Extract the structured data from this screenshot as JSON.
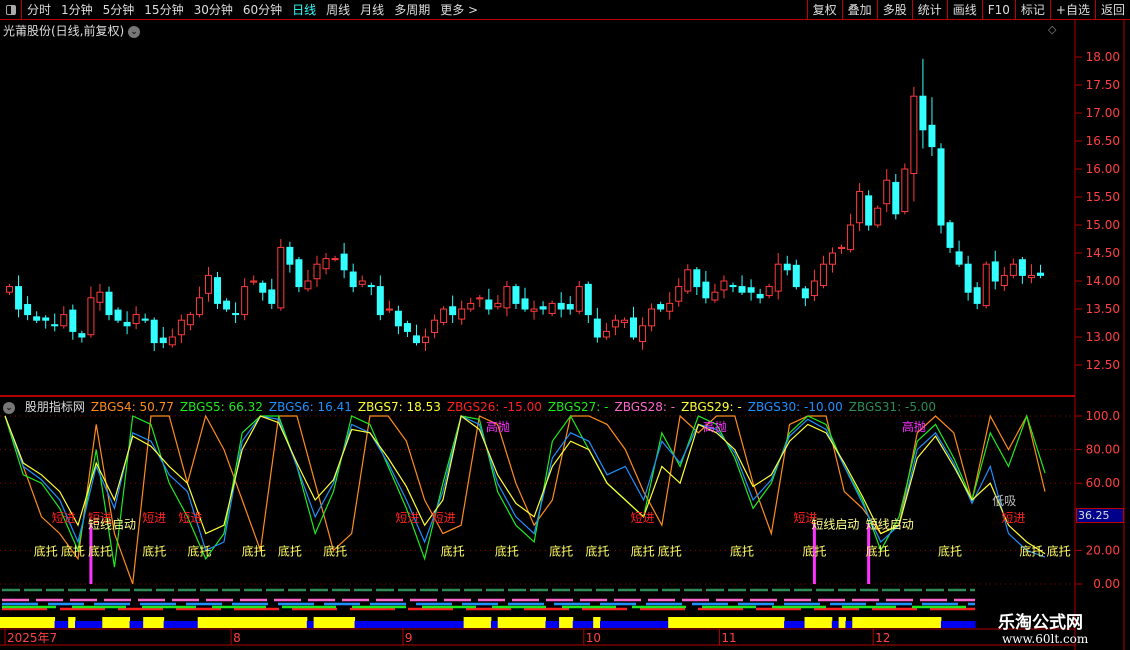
{
  "toolbar": {
    "periods": [
      "分时",
      "1分钟",
      "5分钟",
      "15分钟",
      "30分钟",
      "60分钟",
      "日线",
      "周线",
      "月线",
      "多周期",
      "更多 >"
    ],
    "active": "日线",
    "right": [
      "复权",
      "叠加",
      "多股",
      "统计",
      "画线",
      "F10",
      "标记",
      "+自选",
      "返回"
    ]
  },
  "title": "光莆股份(日线,前复权)",
  "price_axis": [
    "18.00",
    "17.50",
    "17.00",
    "16.50",
    "16.00",
    "15.50",
    "15.00",
    "14.50",
    "14.00",
    "13.50",
    "13.00",
    "12.50"
  ],
  "ind_axis": [
    "100.0",
    "80.00",
    "60.00",
    "20.00",
    "0.00"
  ],
  "current_value": "36.25",
  "indicator": {
    "name": "股朋指标网",
    "items": [
      {
        "t": "ZBGS4: 50.77",
        "c": "#ff8c1a"
      },
      {
        "t": "ZBGS5: 66.32",
        "c": "#1eea1e"
      },
      {
        "t": "ZBGS6: 16.41",
        "c": "#1e90ff"
      },
      {
        "t": "ZBGS7: 18.53",
        "c": "#ffff33"
      },
      {
        "t": "ZBGS26: -15.00",
        "c": "#ff2020"
      },
      {
        "t": "ZBGS27: -",
        "c": "#1eea1e"
      },
      {
        "t": "ZBGS28: -",
        "c": "#ff66cc"
      },
      {
        "t": "ZBGS29: -",
        "c": "#ffff33"
      },
      {
        "t": "ZBGS30: -10.00",
        "c": "#1e90ff"
      },
      {
        "t": "ZBGS31: -5.00",
        "c": "#2e8b57"
      }
    ]
  },
  "colors": {
    "up": "#ff3b3b",
    "down": "#3ff",
    "grid": "#b00000"
  },
  "closes": [
    13.9,
    13.5,
    13.4,
    13.3,
    13.3,
    13.2,
    13.4,
    13.1,
    13.0,
    13.7,
    13.8,
    13.4,
    13.3,
    13.2,
    13.4,
    13.3,
    12.9,
    12.9,
    13.0,
    13.3,
    13.4,
    13.7,
    14.1,
    13.6,
    13.5,
    13.4,
    13.9,
    14.0,
    13.8,
    13.6,
    14.6,
    14.3,
    13.9,
    14.0,
    14.3,
    14.4,
    14.4,
    14.2,
    13.9,
    14.0,
    13.9,
    13.4,
    13.5,
    13.2,
    13.1,
    12.9,
    13.0,
    13.3,
    13.5,
    13.4,
    13.5,
    13.6,
    13.7,
    13.5,
    13.6,
    13.9,
    13.6,
    13.5,
    13.5,
    13.5,
    13.6,
    13.5,
    13.5,
    13.9,
    13.4,
    13.0,
    13.1,
    13.3,
    13.3,
    13.0,
    13.2,
    13.5,
    13.5,
    13.6,
    13.9,
    14.2,
    13.9,
    13.7,
    13.8,
    14.0,
    13.9,
    13.8,
    13.8,
    13.7,
    13.9,
    14.3,
    14.2,
    13.9,
    13.7,
    14.0,
    14.3,
    14.5,
    14.6,
    15.0,
    15.6,
    15.0,
    15.3,
    15.8,
    15.2,
    16.0,
    17.3,
    16.7,
    16.4,
    15.0,
    14.6,
    14.3,
    13.8,
    13.6,
    14.3,
    14.0,
    14.1,
    14.3,
    14.1,
    14.1,
    14.1
  ],
  "months": [
    {
      "label": "2025年7",
      "i": 0
    },
    {
      "label": "8",
      "i": 25
    },
    {
      "label": "9",
      "i": 44
    },
    {
      "label": "10",
      "i": 64
    },
    {
      "label": "11",
      "i": 79
    },
    {
      "label": "12",
      "i": 96
    }
  ],
  "series": [
    {
      "name": "ZBGS4",
      "color": "#ff8c1a",
      "v": [
        100,
        70,
        40,
        30,
        15,
        95,
        30,
        0,
        100,
        100,
        60,
        100,
        80,
        50,
        20,
        100,
        100,
        60,
        20,
        30,
        100,
        100,
        85,
        50,
        30,
        35,
        100,
        95,
        60,
        35,
        50,
        100,
        100,
        95,
        80,
        55,
        35,
        100,
        90,
        100,
        100,
        60,
        30,
        95,
        100,
        100,
        55,
        45,
        30,
        35,
        90,
        100,
        90,
        50,
        100,
        80,
        100,
        55
      ]
    },
    {
      "name": "ZBGS5",
      "color": "#1eea1e",
      "v": [
        100,
        65,
        60,
        45,
        20,
        80,
        10,
        100,
        95,
        60,
        40,
        15,
        30,
        90,
        100,
        100,
        70,
        30,
        55,
        100,
        95,
        70,
        45,
        15,
        60,
        100,
        98,
        55,
        35,
        25,
        85,
        100,
        80,
        60,
        50,
        40,
        90,
        70,
        100,
        95,
        75,
        45,
        60,
        90,
        100,
        95,
        70,
        50,
        20,
        40,
        85,
        95,
        75,
        50,
        90,
        70,
        100,
        66
      ]
    },
    {
      "name": "ZBGS6",
      "color": "#1e90ff",
      "v": [
        100,
        70,
        62,
        50,
        25,
        70,
        45,
        90,
        85,
        65,
        55,
        20,
        25,
        85,
        100,
        98,
        70,
        40,
        60,
        95,
        90,
        72,
        50,
        25,
        55,
        100,
        95,
        60,
        40,
        30,
        75,
        90,
        85,
        65,
        70,
        50,
        85,
        72,
        95,
        92,
        78,
        50,
        62,
        88,
        98,
        92,
        70,
        48,
        25,
        35,
        80,
        90,
        72,
        48,
        70,
        30,
        20,
        16
      ]
    },
    {
      "name": "ZBGS7",
      "color": "#ffff33",
      "v": [
        100,
        72,
        65,
        55,
        35,
        72,
        50,
        88,
        82,
        70,
        60,
        30,
        35,
        80,
        100,
        96,
        72,
        50,
        62,
        92,
        90,
        75,
        58,
        35,
        50,
        100,
        92,
        65,
        48,
        40,
        70,
        85,
        80,
        60,
        50,
        40,
        70,
        60,
        95,
        90,
        80,
        58,
        65,
        85,
        95,
        90,
        72,
        52,
        30,
        35,
        75,
        88,
        70,
        50,
        60,
        35,
        25,
        18
      ]
    }
  ],
  "signals": [
    {
      "t": "短进",
      "c": "#ff2020",
      "i": 6,
      "v": 40
    },
    {
      "t": "短进",
      "c": "#ff2020",
      "i": 10,
      "v": 40
    },
    {
      "t": "短进",
      "c": "#ff2020",
      "i": 16,
      "v": 40
    },
    {
      "t": "短进",
      "c": "#ff2020",
      "i": 20,
      "v": 40
    },
    {
      "t": "短进",
      "c": "#ff2020",
      "i": 44,
      "v": 40
    },
    {
      "t": "短进",
      "c": "#ff2020",
      "i": 48,
      "v": 40
    },
    {
      "t": "短进",
      "c": "#ff2020",
      "i": 70,
      "v": 40
    },
    {
      "t": "短进",
      "c": "#ff2020",
      "i": 88,
      "v": 40
    },
    {
      "t": "短进",
      "c": "#ff2020",
      "i": 111,
      "v": 40
    },
    {
      "t": "短线启动",
      "c": "#ffff88",
      "i": 10,
      "v": 36
    },
    {
      "t": "短线启动",
      "c": "#ffff88",
      "i": 90,
      "v": 36
    },
    {
      "t": "短线启动",
      "c": "#ffff88",
      "i": 96,
      "v": 36
    },
    {
      "t": "底托",
      "c": "#ffff66",
      "i": 4,
      "v": 20
    },
    {
      "t": "底托",
      "c": "#ffff66",
      "i": 7,
      "v": 20
    },
    {
      "t": "底托",
      "c": "#ffff66",
      "i": 10,
      "v": 20
    },
    {
      "t": "底托",
      "c": "#ffff66",
      "i": 16,
      "v": 20
    },
    {
      "t": "底托",
      "c": "#ffff66",
      "i": 21,
      "v": 20
    },
    {
      "t": "底托",
      "c": "#ffff66",
      "i": 27,
      "v": 20
    },
    {
      "t": "底托",
      "c": "#ffff66",
      "i": 31,
      "v": 20
    },
    {
      "t": "底托",
      "c": "#ffff66",
      "i": 36,
      "v": 20
    },
    {
      "t": "底托",
      "c": "#ffff66",
      "i": 49,
      "v": 20
    },
    {
      "t": "底托",
      "c": "#ffff66",
      "i": 55,
      "v": 20
    },
    {
      "t": "底托",
      "c": "#ffff66",
      "i": 61,
      "v": 20
    },
    {
      "t": "底托",
      "c": "#ffff66",
      "i": 65,
      "v": 20
    },
    {
      "t": "底托",
      "c": "#ffff66",
      "i": 70,
      "v": 20
    },
    {
      "t": "底托",
      "c": "#ffff66",
      "i": 73,
      "v": 20
    },
    {
      "t": "底托",
      "c": "#ffff66",
      "i": 81,
      "v": 20
    },
    {
      "t": "底托",
      "c": "#ffff66",
      "i": 89,
      "v": 20
    },
    {
      "t": "底托",
      "c": "#ffff66",
      "i": 96,
      "v": 20
    },
    {
      "t": "底托",
      "c": "#ffff66",
      "i": 104,
      "v": 20
    },
    {
      "t": "底托",
      "c": "#ffff66",
      "i": 113,
      "v": 20
    },
    {
      "t": "底托",
      "c": "#ffff66",
      "i": 116,
      "v": 20
    },
    {
      "t": "高抛",
      "c": "#ff33ff",
      "i": 54,
      "v": 94
    },
    {
      "t": "高抛",
      "c": "#ff33ff",
      "i": 78,
      "v": 94
    },
    {
      "t": "高抛",
      "c": "#ff33ff",
      "i": 100,
      "v": 94
    },
    {
      "t": "低吸",
      "c": "#bbbbbb",
      "i": 110,
      "v": 50
    }
  ],
  "spikes": [
    9,
    89,
    95
  ],
  "state_row": "YYYYYYYYBBYBBBBYYYYBBYYYBBBBBYYYYYYYYYYYYYYYYBYYYYYYBBBBBBBBBBBBBBBBYYYYBYYYYYYYBBYYBBBYBBBBBBBBBBYYYYYYYYYYYYYYYYYBBBYYYYBYBYYYYYYYYYYYYYBBBBB",
  "watermark": {
    "name": "乐淘公式网",
    "url": "www.60lt.com"
  }
}
